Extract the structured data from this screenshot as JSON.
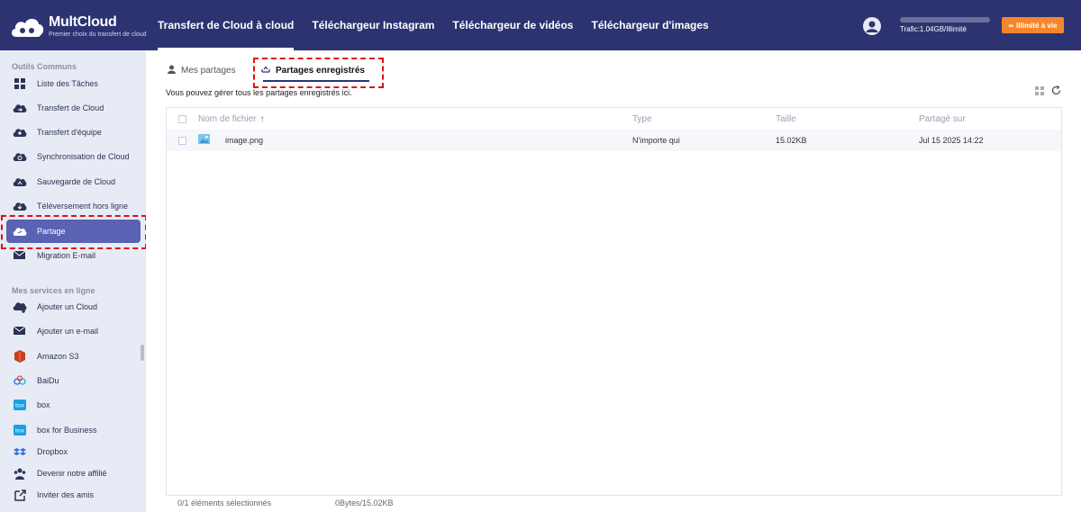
{
  "app": {
    "name": "MultCloud",
    "tagline": "Premier choix du transfert de cloud"
  },
  "nav": {
    "items": [
      {
        "label": "Transfert de Cloud à cloud"
      },
      {
        "label": "Téléchargeur Instagram"
      },
      {
        "label": "Téléchargeur de vidéos"
      },
      {
        "label": "Téléchargeur d'images"
      }
    ],
    "active_index": 0
  },
  "account": {
    "traffic_text": "Trafic:1.04GB/Illimité",
    "upgrade_label": "Illimité à vie"
  },
  "sidebar": {
    "section_common": "Outils Communs",
    "common_items": [
      {
        "label": "Liste des Tâches",
        "icon": "grid-icon"
      },
      {
        "label": "Transfert de Cloud",
        "icon": "cloud-transfer-icon"
      },
      {
        "label": "Transfert d'équipe",
        "icon": "team-transfer-icon"
      },
      {
        "label": "Synchronisation de Cloud",
        "icon": "cloud-sync-icon"
      },
      {
        "label": "Sauvegarde de Cloud",
        "icon": "cloud-backup-icon"
      },
      {
        "label": "Téléversement hors ligne",
        "icon": "offline-upload-icon"
      },
      {
        "label": "Partage",
        "icon": "share-cloud-icon"
      },
      {
        "label": "Migration E-mail",
        "icon": "email-migration-icon"
      }
    ],
    "active_index": 6,
    "section_services": "Mes services en ligne",
    "service_items": [
      {
        "label": "Ajouter un Cloud",
        "icon": "add-cloud-icon"
      },
      {
        "label": "Ajouter un e-mail",
        "icon": "add-email-icon"
      },
      {
        "label": "Amazon S3",
        "icon": "amazon-s3-icon"
      },
      {
        "label": "BaiDu",
        "icon": "baidu-icon"
      },
      {
        "label": "box",
        "icon": "box-icon"
      },
      {
        "label": "box for Business",
        "icon": "box-business-icon"
      },
      {
        "label": "Dropbox",
        "icon": "dropbox-icon"
      }
    ],
    "bottom_items": [
      {
        "label": "Devenir notre affilié",
        "icon": "affiliate-icon"
      },
      {
        "label": "Inviter des amis",
        "icon": "invite-icon"
      }
    ]
  },
  "main": {
    "tabs": [
      {
        "label": "Mes partages"
      },
      {
        "label": "Partages enregistrés"
      }
    ],
    "active_tab": 1,
    "info_text": "Vous pouvez gérer tous les partages enregistrés ici.",
    "table": {
      "headers": {
        "name": "Nom de fichier",
        "type": "Type",
        "size": "Taille",
        "date": "Partagé sur"
      },
      "rows": [
        {
          "name": "image.png",
          "type": "N'importe qui",
          "size": "15.02KB",
          "date": "Jul 15 2025 14:22"
        }
      ]
    },
    "footer": {
      "selected": "0/1 éléments sélectionnés",
      "size": "0Bytes/15.02KB"
    }
  },
  "colors": {
    "header_bg": "#2d3371",
    "sidebar_bg": "#e7ebf6",
    "active_item": "#5a62b3",
    "upgrade_button": "#f5872b",
    "highlight": "#e01010"
  }
}
